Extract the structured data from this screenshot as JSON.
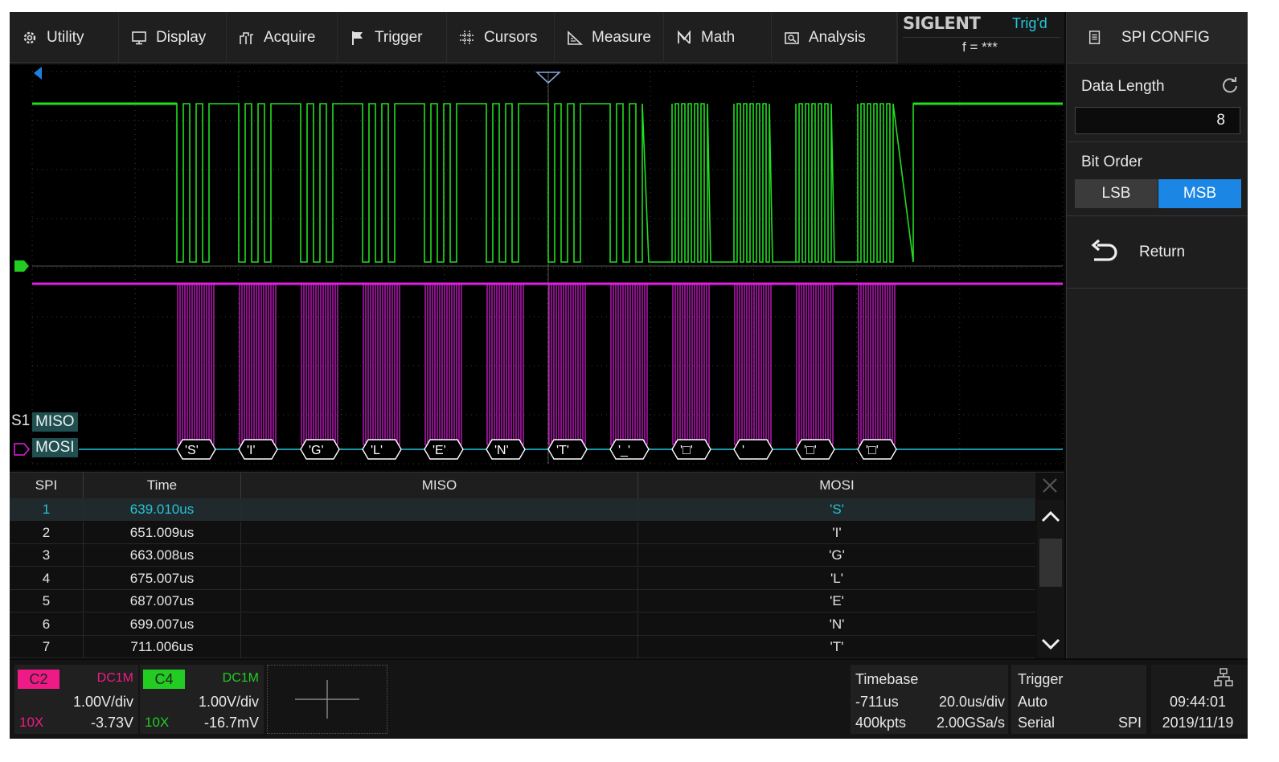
{
  "menu": [
    {
      "label": "Utility",
      "icon": "gear-icon"
    },
    {
      "label": "Display",
      "icon": "monitor-icon"
    },
    {
      "label": "Acquire",
      "icon": "acquire-icon"
    },
    {
      "label": "Trigger",
      "icon": "flag-icon"
    },
    {
      "label": "Cursors",
      "icon": "crosshair-icon"
    },
    {
      "label": "Measure",
      "icon": "ruler-icon"
    },
    {
      "label": "Math",
      "icon": "math-icon"
    },
    {
      "label": "Analysis",
      "icon": "analysis-icon"
    }
  ],
  "brand": {
    "logo": "SIGLENT",
    "status": "Trig'd",
    "freq": "f = ***"
  },
  "panel": {
    "title": "SPI CONFIG",
    "data_length_label": "Data Length",
    "data_length_value": "8",
    "bit_order_label": "Bit Order",
    "lsb": "LSB",
    "msb": "MSB",
    "selected_bit_order": "MSB",
    "return_label": "Return"
  },
  "waveform": {
    "s1_label": "S1",
    "miso_tag": "MISO",
    "mosi_tag": "MOSI",
    "decoded_bytes": [
      "'S'",
      "'I'",
      "'G'",
      "'L'",
      "'E'",
      "'N'",
      "'T'",
      "'_'",
      "'□'",
      "'",
      "'□'",
      "'□'"
    ],
    "ch4_color": "#22dd22",
    "ch2_color": "#e020e0",
    "bus_color": "#22c8e0"
  },
  "table": {
    "headers": {
      "spi": "SPI",
      "time": "Time",
      "miso": "MISO",
      "mosi": "MOSI"
    },
    "rows": [
      {
        "spi": "1",
        "time": "639.010us",
        "miso": "",
        "mosi": "'S'"
      },
      {
        "spi": "2",
        "time": "651.009us",
        "miso": "",
        "mosi": "'I'"
      },
      {
        "spi": "3",
        "time": "663.008us",
        "miso": "",
        "mosi": "'G'"
      },
      {
        "spi": "4",
        "time": "675.007us",
        "miso": "",
        "mosi": "'L'"
      },
      {
        "spi": "5",
        "time": "687.007us",
        "miso": "",
        "mosi": "'E'"
      },
      {
        "spi": "6",
        "time": "699.007us",
        "miso": "",
        "mosi": "'N'"
      },
      {
        "spi": "7",
        "time": "711.006us",
        "miso": "",
        "mosi": "'T'"
      }
    ]
  },
  "status": {
    "c2": {
      "tag": "C2",
      "coupling": "DC1M",
      "vdiv": "1.00V/div",
      "probe": "10X",
      "offset": "-3.73V",
      "color": "#ee1a86"
    },
    "c4": {
      "tag": "C4",
      "coupling": "DC1M",
      "vdiv": "1.00V/div",
      "probe": "10X",
      "offset": "-16.7mV",
      "color": "#22cc22"
    },
    "timebase": {
      "label": "Timebase",
      "delay": "-711us",
      "tdiv": "20.0us/div",
      "points": "400kpts",
      "rate": "2.00GSa/s"
    },
    "trigger": {
      "label": "Trigger",
      "mode": "Auto",
      "type": "Serial",
      "source": "SPI"
    },
    "time": "09:44:01",
    "date": "2019/11/19"
  }
}
